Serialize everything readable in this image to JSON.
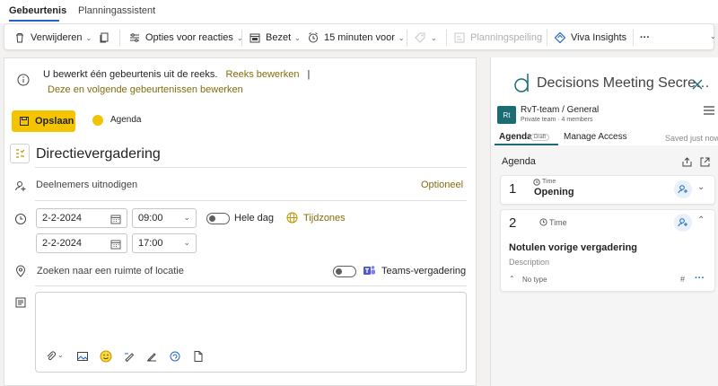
{
  "tabs": {
    "events": "Gebeurtenis",
    "assistant": "Planningassistent"
  },
  "toolbar": {
    "delete": "Verwijderen",
    "response_options": "Opties voor reacties",
    "busy": "Bezet",
    "reminder": "15 minuten voor",
    "poll": "Planningspeiling",
    "viva": "Viva Insights",
    "more": "···"
  },
  "info": {
    "message": "U bewerkt één gebeurtenis uit de reeks.",
    "edit_series": "Reeks bewerken",
    "separator": "|",
    "edit_following": "Deze en volgende gebeurtenissen bewerken"
  },
  "actions": {
    "save": "Opslaan",
    "calendar": "Agenda"
  },
  "event": {
    "title": "Directievergadering",
    "invite_placeholder": "Deelnemers uitnodigen",
    "optional": "Optioneel",
    "start_date": "2-2-2024",
    "start_time": "09:00",
    "all_day": "Hele dag",
    "timezones": "Tijdzones",
    "end_date": "2-2-2024",
    "end_time": "17:00",
    "location_placeholder": "Zoeken naar een ruimte of locatie",
    "teams_meeting": "Teams-vergadering"
  },
  "addin": {
    "title": "Decisions Meeting Secre…",
    "team_initials": "Rt",
    "team_name": "RvT-team / General",
    "team_meta": "Private team · 4 members",
    "tab_agenda": "Agenda",
    "draft_badge": "Draft",
    "tab_access": "Manage Access",
    "saved": "Saved just now",
    "section_title": "Agenda",
    "items": [
      {
        "number": "1",
        "time_label": "Time",
        "title": "Opening"
      },
      {
        "number": "2",
        "time_label": "Time",
        "title": "Notulen vorige vergadering",
        "description": "Description",
        "type": "No type",
        "hash": "#",
        "more": "···"
      }
    ]
  }
}
